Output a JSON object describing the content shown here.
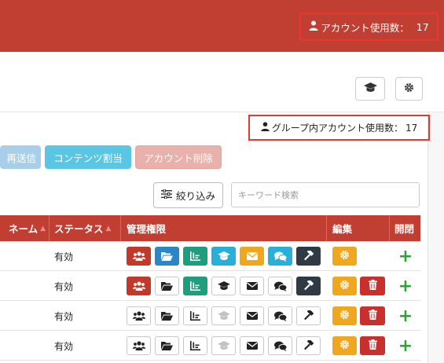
{
  "header": {
    "account_usage_label": "アカウント使用数：",
    "account_usage_value": "17"
  },
  "group": {
    "usage_label": "グループ内アカウント使用数：",
    "usage_value": "17"
  },
  "actions": {
    "resend": "再送信",
    "content_assign": "コンテンツ割当",
    "account_delete": "アカウント削除"
  },
  "filter": {
    "label": "絞り込み",
    "search_placeholder": "キーワード検索"
  },
  "table": {
    "columns": [
      "ネーム",
      "ステータス",
      "管理権限",
      "編集",
      "開閉"
    ],
    "permission_icons": [
      "users-icon",
      "folder-open-icon",
      "chart-icon",
      "graduation-cap-icon",
      "envelope-icon",
      "comments-icon",
      "gavel-icon"
    ],
    "permission_colors": [
      "#c0392b",
      "#2b86c5",
      "#1e9e7e",
      "#2ab0d8",
      "#f0a720",
      "#2ab0d8",
      "#2f3a45"
    ],
    "rows": [
      {
        "status": "有効",
        "perms": [
          true,
          true,
          true,
          true,
          true,
          true,
          true
        ],
        "perms_disabled": [
          false,
          false,
          false,
          false,
          false,
          false,
          false
        ],
        "can_delete": false
      },
      {
        "status": "有効",
        "perms": [
          true,
          false,
          true,
          false,
          false,
          false,
          true
        ],
        "perms_disabled": [
          false,
          false,
          false,
          false,
          false,
          false,
          false
        ],
        "can_delete": true
      },
      {
        "status": "有効",
        "perms": [
          false,
          false,
          false,
          false,
          false,
          false,
          false
        ],
        "perms_disabled": [
          false,
          false,
          false,
          true,
          false,
          false,
          false
        ],
        "can_delete": true
      },
      {
        "status": "有効",
        "perms": [
          false,
          false,
          false,
          false,
          false,
          false,
          false
        ],
        "perms_disabled": [
          false,
          false,
          false,
          true,
          false,
          false,
          false
        ],
        "can_delete": true
      }
    ]
  },
  "colors": {
    "brand_red": "#c13e32",
    "highlight_border": "#e8382e",
    "edit_orange": "#f0a720",
    "delete_red": "#c9302c",
    "open_green": "#2ea338"
  }
}
